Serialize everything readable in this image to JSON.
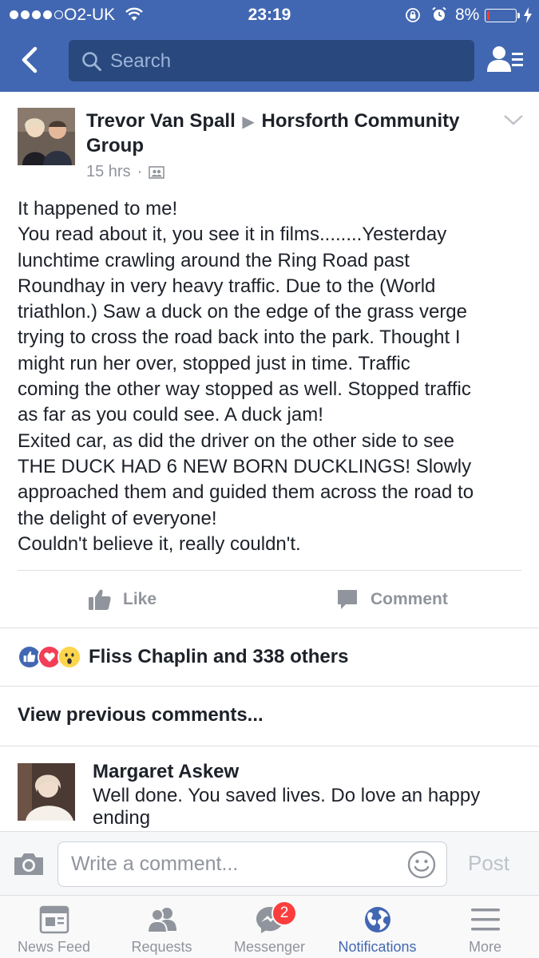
{
  "status_bar": {
    "carrier": "O2-UK",
    "time": "23:19",
    "battery_percent": "8%",
    "battery_level": 0.08,
    "signal_bars": 4,
    "battery_color": "#ff3b30"
  },
  "nav": {
    "search_placeholder": "Search",
    "bar_color": "#4267b2",
    "search_bg": "#29487d"
  },
  "post": {
    "author": "Trevor Van Spall",
    "group": "Horsforth Community Group",
    "time": "15 hrs",
    "separator": "·",
    "lines": [
      "It happened to me!",
      "You read about it, you see it in films........Yesterday",
      "lunchtime crawling around the Ring Road past",
      "Roundhay in very heavy traffic. Due to the (World",
      "triathlon.) Saw a duck on the edge of the grass verge",
      "trying to cross the road back into the park. Thought I",
      "might run her over, stopped just in time. Traffic",
      "coming the other way stopped as well. Stopped traffic",
      "as far as you could see. A duck jam!",
      "Exited car, as did the driver on the other side to see",
      "THE DUCK HAD 6 NEW BORN DUCKLINGS! Slowly",
      "approached them and guided them across the road to",
      "the delight of everyone!",
      "Couldn't believe it, really couldn't."
    ]
  },
  "actions": {
    "like_label": "Like",
    "comment_label": "Comment"
  },
  "reactions": {
    "text": "Fliss Chaplin and 338 others",
    "types": [
      "like-icon",
      "love-icon",
      "wow-icon"
    ]
  },
  "comments": {
    "view_previous": "View previous comments...",
    "items": [
      {
        "author": "Margaret Askew",
        "text": "Well done. You saved lives. Do love an happy ending"
      }
    ]
  },
  "composer": {
    "placeholder": "Write a comment...",
    "post_label": "Post"
  },
  "tabs": [
    {
      "label": "News Feed",
      "icon": "news-feed-icon",
      "active": false
    },
    {
      "label": "Requests",
      "icon": "requests-icon",
      "active": false
    },
    {
      "label": "Messenger",
      "icon": "messenger-icon",
      "active": false,
      "badge": "2"
    },
    {
      "label": "Notifications",
      "icon": "globe-icon",
      "active": true
    },
    {
      "label": "More",
      "icon": "menu-icon",
      "active": false
    }
  ],
  "colors": {
    "brand_blue": "#4267b2",
    "badge_red": "#fa3e3e",
    "muted_text": "#90949c"
  }
}
